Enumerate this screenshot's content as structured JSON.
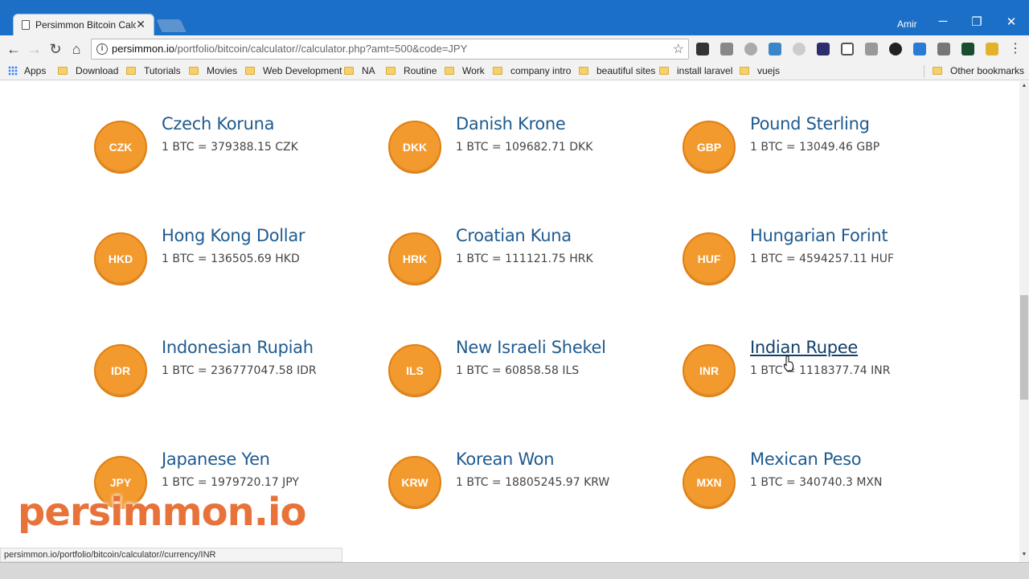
{
  "browser": {
    "tab_title": "Persimmon Bitcoin Calcu",
    "user_name": "Amir",
    "url_host": "persimmon.io",
    "url_path": "/portfolio/bitcoin/calculator//calculator.php?amt=500&code=JPY",
    "status_url": "persimmon.io/portfolio/bitcoin/calculator//currency/INR"
  },
  "bookmarks": [
    {
      "label": "Apps",
      "type": "apps"
    },
    {
      "label": "Download",
      "type": "folder"
    },
    {
      "label": "Tutorials",
      "type": "folder"
    },
    {
      "label": "Movies",
      "type": "folder"
    },
    {
      "label": "Web Development",
      "type": "folder"
    },
    {
      "label": "NA",
      "type": "folder"
    },
    {
      "label": "Routine",
      "type": "folder"
    },
    {
      "label": "Work",
      "type": "folder"
    },
    {
      "label": "company intro",
      "type": "folder"
    },
    {
      "label": "beautiful sites",
      "type": "folder"
    },
    {
      "label": "install laravel",
      "type": "folder"
    },
    {
      "label": "vuejs",
      "type": "folder"
    }
  ],
  "other_bookmarks": "Other bookmarks",
  "currencies": [
    {
      "code": "CZK",
      "name": "Czech Koruna",
      "rate": "1 BTC = 379388.15 CZK"
    },
    {
      "code": "DKK",
      "name": "Danish Krone",
      "rate": "1 BTC = 109682.71 DKK"
    },
    {
      "code": "GBP",
      "name": "Pound Sterling",
      "rate": "1 BTC = 13049.46 GBP"
    },
    {
      "code": "HKD",
      "name": "Hong Kong Dollar",
      "rate": "1 BTC = 136505.69 HKD"
    },
    {
      "code": "HRK",
      "name": "Croatian Kuna",
      "rate": "1 BTC = 111121.75 HRK"
    },
    {
      "code": "HUF",
      "name": "Hungarian Forint",
      "rate": "1 BTC = 4594257.11 HUF"
    },
    {
      "code": "IDR",
      "name": "Indonesian Rupiah",
      "rate": "1 BTC = 236777047.58 IDR"
    },
    {
      "code": "ILS",
      "name": "New Israeli Shekel",
      "rate": "1 BTC = 60858.58 ILS"
    },
    {
      "code": "INR",
      "name": "Indian Rupee",
      "rate": "1 BTC = 1118377.74 INR",
      "hovered": true
    },
    {
      "code": "JPY",
      "name": "Japanese Yen",
      "rate": "1 BTC = 1979720.17 JPY"
    },
    {
      "code": "KRW",
      "name": "Korean Won",
      "rate": "1 BTC = 18805245.97 KRW"
    },
    {
      "code": "MXN",
      "name": "Mexican Peso",
      "rate": "1 BTC = 340740.3 MXN"
    }
  ],
  "watermark": "persimmon.io",
  "colors": {
    "coin": "#f39a2e",
    "link": "#1f5b8f",
    "chrome_blue": "#1b6fc7"
  }
}
